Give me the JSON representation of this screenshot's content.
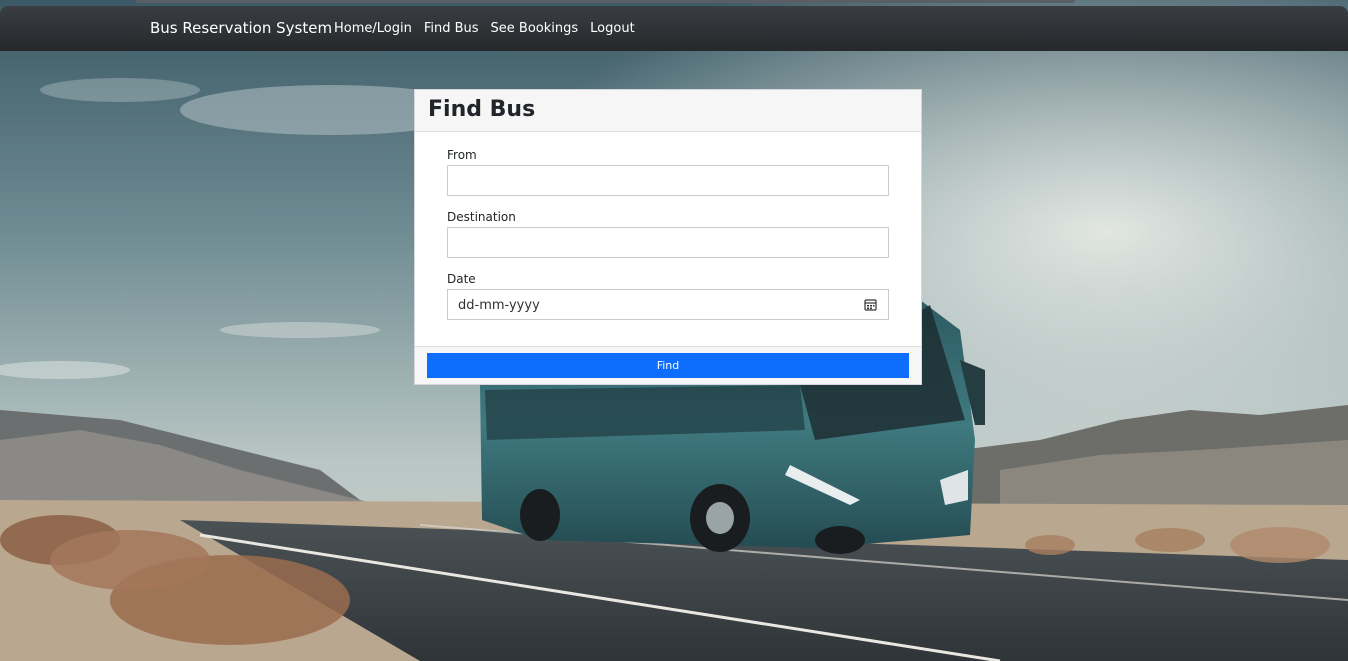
{
  "navbar": {
    "brand": "Bus Reservation System",
    "links": [
      {
        "label": "Home/Login"
      },
      {
        "label": "Find Bus"
      },
      {
        "label": "See Bookings"
      },
      {
        "label": "Logout"
      }
    ],
    "color": "#2f3336"
  },
  "form": {
    "title": "Find Bus",
    "from_label": "From",
    "from_value": "",
    "destination_label": "Destination",
    "destination_value": "",
    "date_label": "Date",
    "date_placeholder": "dd-mm-yyyy",
    "date_icon": "calendar-icon",
    "submit_label": "Find",
    "submit_color": "#0d6efd"
  },
  "background": {
    "description_icon": "bus-on-desert-road-photo"
  }
}
